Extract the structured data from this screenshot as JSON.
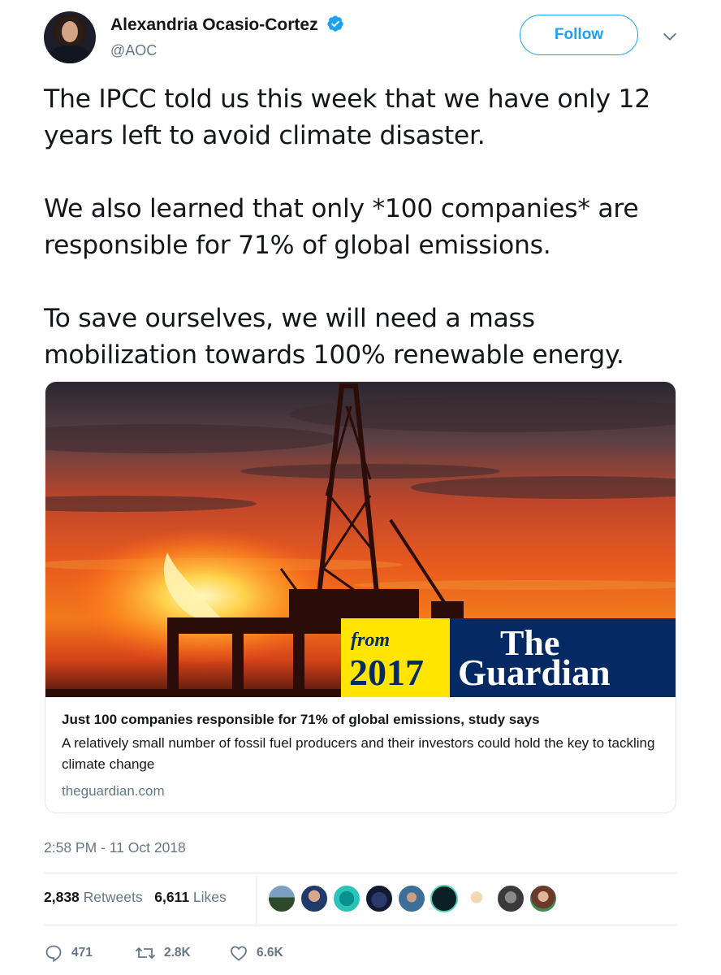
{
  "author": {
    "name": "Alexandria Ocasio-Cortez",
    "handle": "@AOC",
    "verified": true
  },
  "follow_label": "Follow",
  "tweet": {
    "paragraphs": [
      "The IPCC told us this week that we have only 12 years left to avoid climate disaster.",
      "We also learned that only *100 companies* are responsible for 71% of global emissions.",
      "To save ourselves, we will need a mass mobilization towards 100% renewable energy."
    ]
  },
  "card": {
    "image_badge_from": "from",
    "image_badge_year": "2017",
    "image_brand_line1": "The",
    "image_brand_line2": "Guardian",
    "title": "Just 100 companies responsible for 71% of global emissions, study says",
    "description": "A relatively small number of fossil fuel producers and their investors could hold the key to tackling climate change",
    "domain": "theguardian.com"
  },
  "timestamp": "2:58 PM - 11 Oct 2018",
  "stats": {
    "retweets_count": "2,838",
    "retweets_label": "Retweets",
    "likes_count": "6,611",
    "likes_label": "Likes"
  },
  "actions": {
    "replies": "471",
    "retweets": "2.8K",
    "likes": "6.6K"
  },
  "colors": {
    "accent": "#1da1f2",
    "guardian_blue": "#052962",
    "badge_yellow": "#ffe500",
    "muted_text": "#657786"
  },
  "icons": [
    "verified-badge-icon",
    "chevron-down-icon",
    "reply-icon",
    "retweet-icon",
    "heart-icon"
  ]
}
